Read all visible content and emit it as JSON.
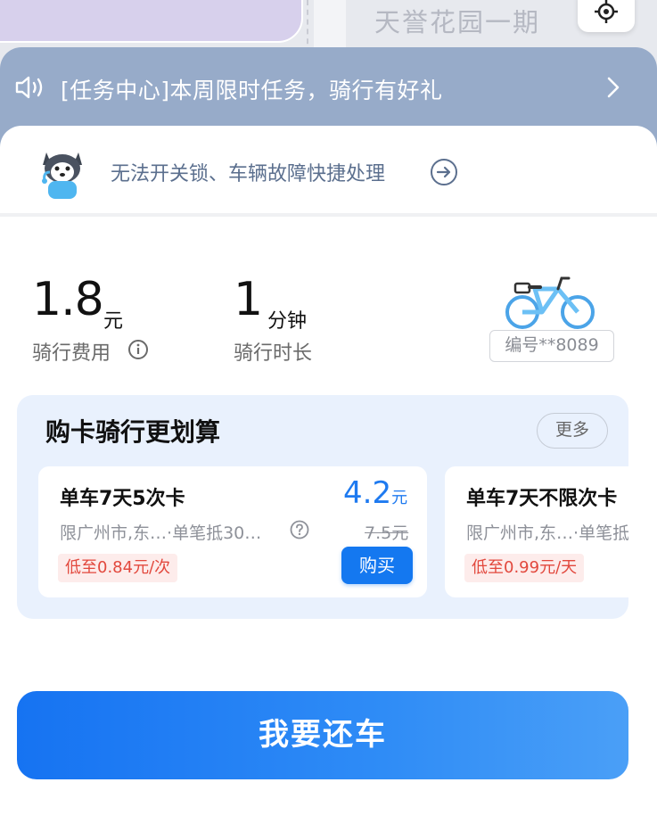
{
  "map": {
    "place_label": "天誉花园一期"
  },
  "notice": {
    "text": "[任务中心]本周限时任务，骑行有好礼"
  },
  "help": {
    "text": "无法开关锁、车辆故障快捷处理"
  },
  "ride": {
    "fee_value": "1.8",
    "fee_unit": "元",
    "fee_label": "骑行费用",
    "duration_value": "1",
    "duration_unit": "分钟",
    "duration_label": "骑行时长",
    "bike_id": "编号**8089"
  },
  "promo": {
    "title": "购卡骑行更划算",
    "more_label": "更多",
    "cards": [
      {
        "name": "单车7天5次卡",
        "desc": "限广州市,东…·单笔抵30…",
        "tag": "低至0.84元/次",
        "price": "4.2",
        "price_unit": "元",
        "old_price": "7.5元",
        "buy_label": "购买"
      },
      {
        "name": "单车7天不限次卡",
        "desc": "限广州市,东…·单笔抵",
        "tag": "低至0.99元/天"
      }
    ]
  },
  "actions": {
    "return_label": "我要还车"
  },
  "colors": {
    "accent": "#1478f0",
    "notice_bg": "#97abc9",
    "promo_bg": "#e9f1fd",
    "tag_red": "#e2483d"
  }
}
